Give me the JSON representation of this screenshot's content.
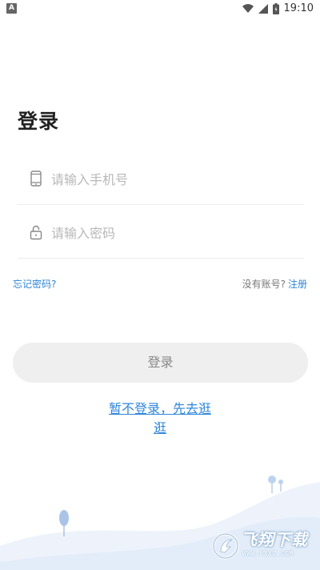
{
  "status_bar": {
    "left_icon": "A",
    "time": "19:10",
    "icons": [
      "wifi-icon",
      "signal-icon",
      "battery-icon"
    ]
  },
  "page": {
    "title": "登录"
  },
  "form": {
    "phone": {
      "placeholder": "请输入手机号",
      "value": "",
      "icon": "phone-icon"
    },
    "password": {
      "placeholder": "请输入密码",
      "value": "",
      "icon": "lock-icon"
    },
    "forgot_password": "忘记密码?",
    "no_account": "没有账号?",
    "register": "注册",
    "login_button": "登录",
    "guest_link": "暂不登录，先去逛逛"
  },
  "watermark": {
    "text": "飞翔下载",
    "url": "WWW.FXXZ.COM"
  },
  "colors": {
    "link": "#2f86d9",
    "button_bg": "#efefef",
    "hill": "#e3edf9"
  }
}
